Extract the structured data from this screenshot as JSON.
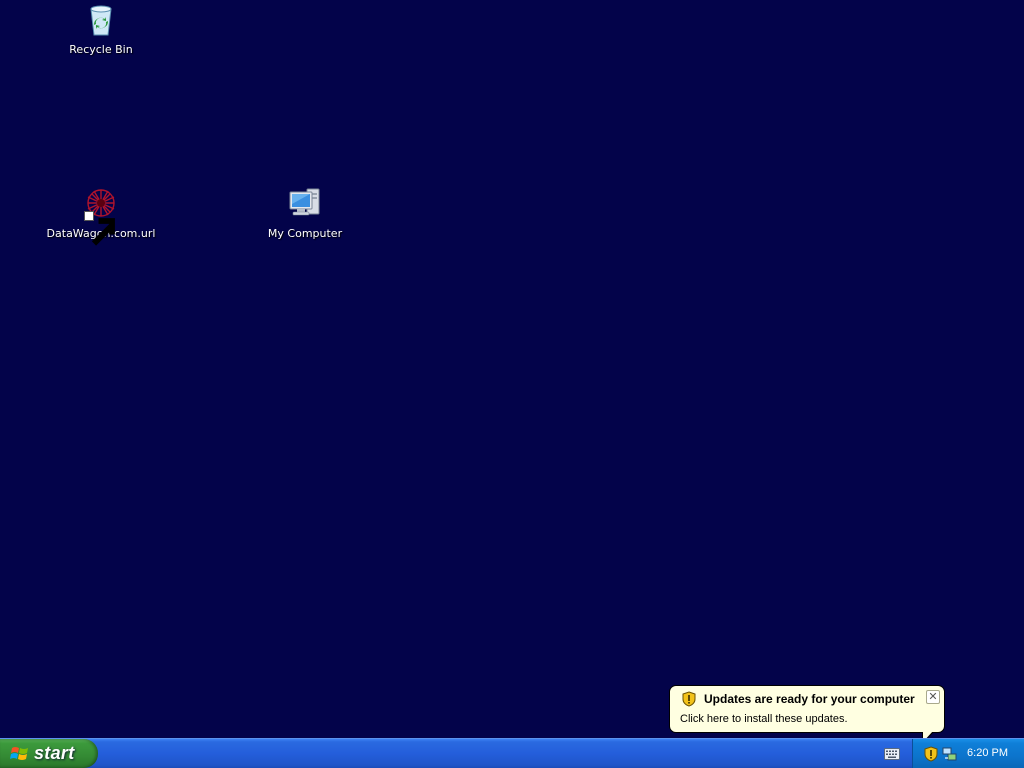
{
  "desktop": {
    "background_color": "#03034a",
    "icons": [
      {
        "label": "Recycle Bin",
        "icon": "recycle-bin-icon"
      },
      {
        "label": "DataWagon.com.url",
        "icon": "internet-shortcut-icon"
      },
      {
        "label": "My Computer",
        "icon": "my-computer-icon"
      }
    ]
  },
  "taskbar": {
    "start_label": "start",
    "quicklaunch_icon": "keyboard-icon",
    "tray": {
      "icons": [
        "security-shield-icon",
        "network-icon"
      ],
      "clock": "6:20 PM"
    }
  },
  "balloon": {
    "title": "Updates are ready for your computer",
    "body": "Click here to install these updates.",
    "close_glyph": "✕",
    "icon": "security-shield-icon"
  },
  "colors": {
    "taskbar_blue": "#245edb",
    "start_green": "#3c9a3c",
    "tray_blue": "#0c74cc",
    "balloon_bg": "#ffffe1"
  }
}
